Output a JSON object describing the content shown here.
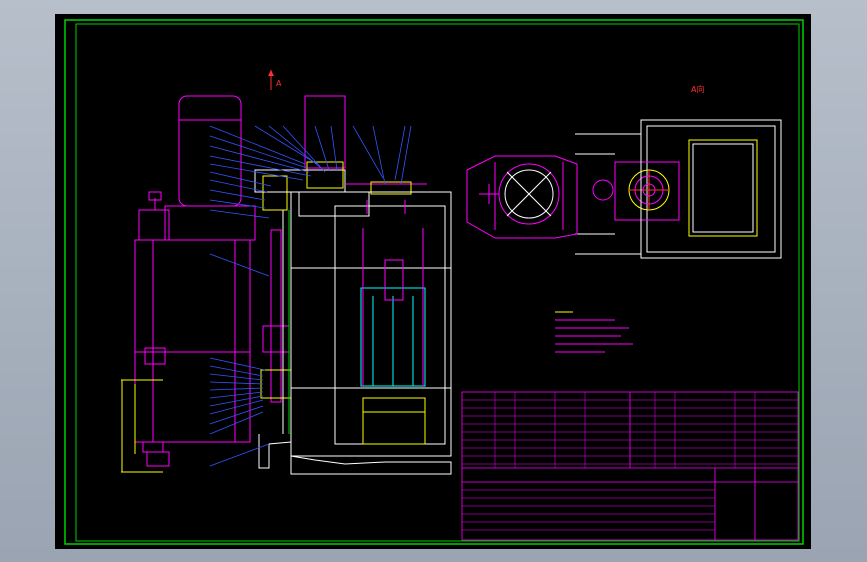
{
  "colors": {
    "background": "#000000",
    "app_chrome": "#a7b0bd",
    "frame": "#00d000",
    "title_block": "#ff00ff",
    "machine": "#ff00ff",
    "leader": "#3355ff",
    "annotation": "#ffff00",
    "inner_part": "#00ffff",
    "body_line": "#ffffff",
    "red_mark": "#ff3030"
  },
  "views": {
    "section_label": "A",
    "aux_view_label": "A向"
  },
  "icons": [
    "section-arrow-icon",
    "center-mark-icon"
  ]
}
